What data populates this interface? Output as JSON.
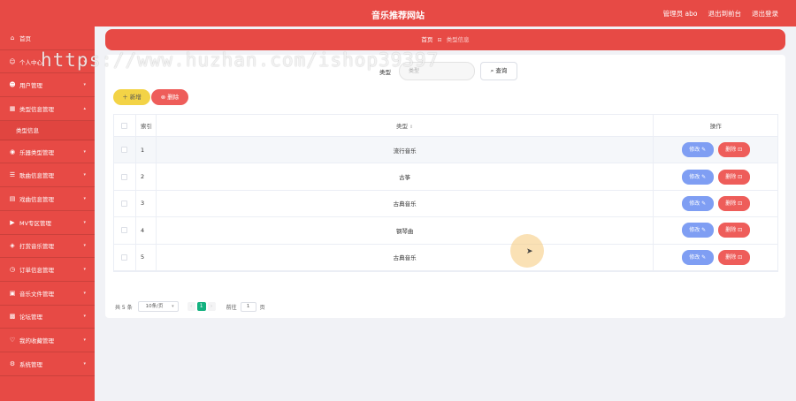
{
  "header": {
    "title": "音乐推荐网站",
    "admin_label": "管理员 abo",
    "backend_link": "退出到前台",
    "logout_link": "退出登录"
  },
  "sidebar": {
    "items": [
      {
        "icon": "home-icon",
        "label": "首页",
        "has_arrow": false
      },
      {
        "icon": "user-icon",
        "label": "个人中心",
        "has_arrow": true
      },
      {
        "icon": "users-icon",
        "label": "用户管理",
        "has_arrow": true
      },
      {
        "icon": "grid-icon",
        "label": "类型信息管理",
        "has_arrow": true
      },
      {
        "icon": "disc-icon",
        "label": "乐器类型管理",
        "has_arrow": true
      },
      {
        "icon": "list-icon",
        "label": "歌曲信息管理",
        "has_arrow": true
      },
      {
        "icon": "grid-icon",
        "label": "戏曲信息管理",
        "has_arrow": true
      },
      {
        "icon": "video-icon",
        "label": "MV专区管理",
        "has_arrow": true
      },
      {
        "icon": "shield-icon",
        "label": "打赏音乐管理",
        "has_arrow": true
      },
      {
        "icon": "clock-icon",
        "label": "订单信息管理",
        "has_arrow": true
      },
      {
        "icon": "file-icon",
        "label": "音乐文件管理",
        "has_arrow": true
      },
      {
        "icon": "chat-icon",
        "label": "论坛管理",
        "has_arrow": true
      },
      {
        "icon": "heart-icon",
        "label": "我的收藏管理",
        "has_arrow": true
      },
      {
        "icon": "gear-icon",
        "label": "系统管理",
        "has_arrow": true
      }
    ],
    "submenu_active": "类型信息"
  },
  "breadcrumb": {
    "home": "首页",
    "current": "类型信息"
  },
  "search": {
    "label": "类型",
    "placeholder": "类型",
    "button_label": "查询"
  },
  "actions": {
    "add_label": "新增",
    "delete_label": "删除"
  },
  "table": {
    "columns": {
      "index": "索引",
      "type": "类型",
      "ops": "操作"
    },
    "rows": [
      {
        "index": "1",
        "type": "流行音乐"
      },
      {
        "index": "2",
        "type": "古筝"
      },
      {
        "index": "3",
        "type": "古典音乐"
      },
      {
        "index": "4",
        "type": "钢琴曲"
      },
      {
        "index": "5",
        "type": "古典音乐"
      }
    ],
    "edit_label": "修改",
    "row_delete_label": "删除"
  },
  "pager": {
    "total": "共 5 条",
    "page_size": "10条/页",
    "current_page": "1",
    "goto_label": "前往",
    "goto_value": "1",
    "goto_unit": "页"
  },
  "watermark": "https://www.huzhan.com/ishop39397",
  "colors": {
    "primary": "#e74a45",
    "add_button": "#f3d346",
    "edit_button": "#7f9ef3",
    "active_page": "#13b17f"
  }
}
